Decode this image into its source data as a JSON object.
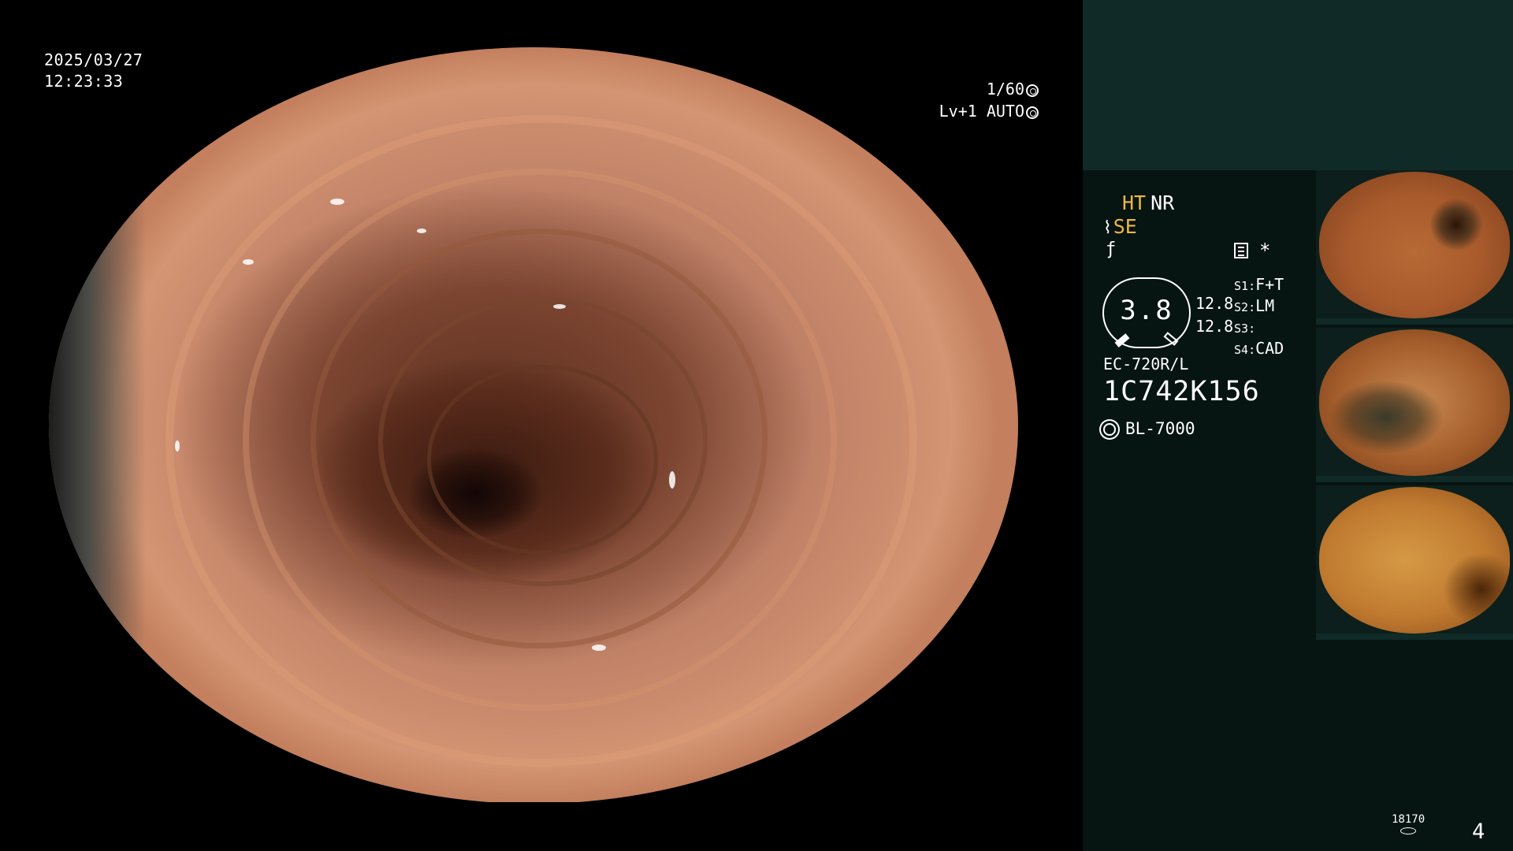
{
  "overlay": {
    "date": "2025/03/27",
    "time": "12:23:33",
    "shutter": "1/60",
    "level_auto": "Lv+1 AUTO"
  },
  "panel": {
    "mode_ht": "HT",
    "mode_nr": "NR",
    "mode_se": "SE",
    "gauge_value": "3.8",
    "value_upper": "12.8",
    "value_lower": "12.8",
    "scopes": [
      {
        "key": "S1",
        "value": "F+T"
      },
      {
        "key": "S2",
        "value": "LM"
      },
      {
        "key": "S3",
        "value": ""
      },
      {
        "key": "S4",
        "value": "CAD"
      }
    ],
    "model": "EC-720R/L",
    "serial": "1C742K156",
    "light_source": "BL-7000",
    "image_count": "18170",
    "page_number": "4"
  },
  "icons": {
    "shutter": "aperture-icon",
    "auto": "iris-icon",
    "enhance": "tilde-icon",
    "fstar": "f-icon",
    "menu": "menu-icon",
    "star": "asterisk-icon",
    "light": "sun-icon",
    "storage": "disk-icon"
  },
  "colors": {
    "panel_bg": "#061412",
    "panel_top_bg": "#0f2a27",
    "accent_yellow": "#f0b840"
  }
}
